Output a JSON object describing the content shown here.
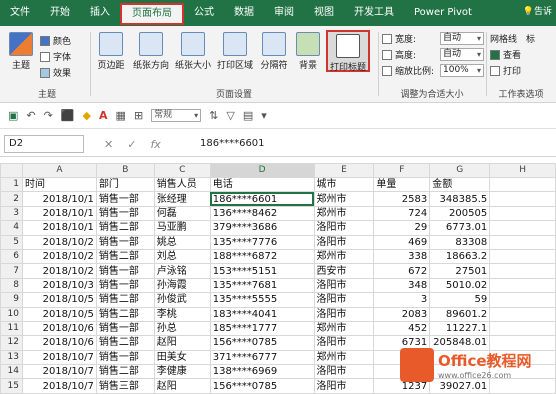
{
  "tabs": [
    "文件",
    "开始",
    "插入",
    "页面布局",
    "公式",
    "数据",
    "审阅",
    "视图",
    "开发工具",
    "Power Pivot"
  ],
  "active_tab": "页面布局",
  "ribbon": {
    "theme_group": {
      "label": "主题",
      "btn": "主题",
      "colors": "颜色",
      "fonts": "字体",
      "effects": "效果"
    },
    "page_setup_group": {
      "label": "页面设置",
      "margins": "页边距",
      "orientation": "纸张方向",
      "size": "纸张大小",
      "print_area": "打印区域",
      "breaks": "分隔符",
      "background": "背景",
      "print_titles": "打印标题"
    },
    "scale_group": {
      "label": "调整为合适大小",
      "width_label": "宽度:",
      "width_val": "自动",
      "height_label": "高度:",
      "height_val": "自动",
      "scale_label": "缩放比例:",
      "scale_val": "100%"
    },
    "sheet_opts_group": {
      "label": "工作表选项",
      "gridlines": "网格线",
      "view": "查看",
      "print": "打印"
    },
    "right_trunc": "标",
    "share_trunc": "告诉"
  },
  "qat": {
    "style_combo": "常规"
  },
  "formula_bar": {
    "name_box": "D2",
    "value": "186****6601"
  },
  "columns": [
    "A",
    "B",
    "C",
    "D",
    "E",
    "F",
    "G",
    "H"
  ],
  "rows": [
    {
      "n": "1",
      "cells": [
        "时间",
        "部门",
        "销售人员",
        "电话",
        "城市",
        "单量",
        "金额",
        ""
      ]
    },
    {
      "n": "2",
      "cells": [
        "2018/10/1",
        "销售一部",
        "张经理",
        "186****6601",
        "郑州市",
        "2583",
        "348385.5",
        ""
      ]
    },
    {
      "n": "3",
      "cells": [
        "2018/10/1",
        "销售一部",
        "何磊",
        "136****8462",
        "郑州市",
        "724",
        "200505",
        ""
      ]
    },
    {
      "n": "4",
      "cells": [
        "2018/10/1",
        "销售二部",
        "马亚鹏",
        "379****3686",
        "洛阳市",
        "29",
        "6773.01",
        ""
      ]
    },
    {
      "n": "5",
      "cells": [
        "2018/10/2",
        "销售一部",
        "姚总",
        "135****7776",
        "洛阳市",
        "469",
        "83308",
        ""
      ]
    },
    {
      "n": "6",
      "cells": [
        "2018/10/2",
        "销售二部",
        "刘总",
        "188****6872",
        "郑州市",
        "338",
        "18663.2",
        ""
      ]
    },
    {
      "n": "7",
      "cells": [
        "2018/10/2",
        "销售一部",
        "卢泳铭",
        "153****5151",
        "西安市",
        "672",
        "27501",
        ""
      ]
    },
    {
      "n": "8",
      "cells": [
        "2018/10/3",
        "销售一部",
        "孙海霞",
        "135****7681",
        "洛阳市",
        "348",
        "5010.02",
        ""
      ]
    },
    {
      "n": "9",
      "cells": [
        "2018/10/5",
        "销售二部",
        "孙俊武",
        "135****5555",
        "洛阳市",
        "3",
        "59",
        ""
      ]
    },
    {
      "n": "10",
      "cells": [
        "2018/10/5",
        "销售二部",
        "李桃",
        "183****4041",
        "洛阳市",
        "2083",
        "89601.2",
        ""
      ]
    },
    {
      "n": "11",
      "cells": [
        "2018/10/6",
        "销售一部",
        "孙总",
        "185****1777",
        "郑州市",
        "452",
        "11227.1",
        ""
      ]
    },
    {
      "n": "12",
      "cells": [
        "2018/10/6",
        "销售二部",
        "赵阳",
        "156****0785",
        "洛阳市",
        "6731",
        "205848.01",
        ""
      ]
    },
    {
      "n": "13",
      "cells": [
        "2018/10/7",
        "销售一部",
        "田美女",
        "371****6777",
        "郑州市",
        "",
        "",
        ""
      ]
    },
    {
      "n": "14",
      "cells": [
        "2018/10/7",
        "销售二部",
        "李健康",
        "138****6969",
        "洛阳市",
        "",
        "",
        ""
      ]
    },
    {
      "n": "15",
      "cells": [
        "2018/10/7",
        "销售三部",
        "赵阳",
        "156****0785",
        "洛阳市",
        "1237",
        "39027.01",
        ""
      ]
    }
  ],
  "watermark": {
    "title": "Office教程网",
    "sub": "www.office26.com"
  },
  "colors": {
    "excel_green": "#217346",
    "highlight_red": "#d0342c",
    "logo_orange": "#e95a2a"
  }
}
